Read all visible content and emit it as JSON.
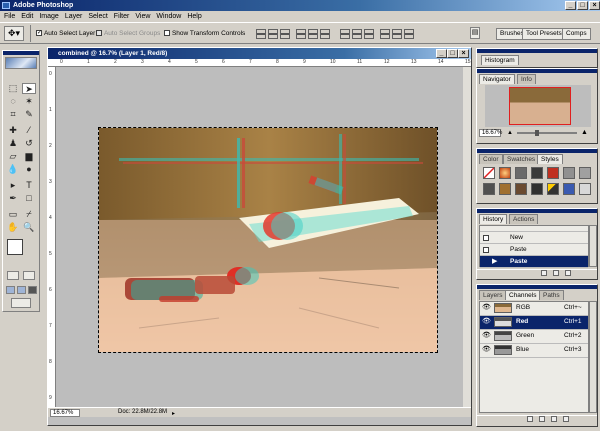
{
  "app": {
    "title": "Adobe Photoshop"
  },
  "menu": [
    "File",
    "Edit",
    "Image",
    "Layer",
    "Select",
    "Filter",
    "View",
    "Window",
    "Help"
  ],
  "options": {
    "auto_select_layer": "Auto Select Layer",
    "auto_select_groups": "Auto Select Groups",
    "show_transform_controls": "Show Transform Controls"
  },
  "palette_well": {
    "tabs": [
      "Brushes",
      "Tool Presets",
      "Comps"
    ]
  },
  "document": {
    "title": "combined @ 16.7% (Layer 1, Red/8)",
    "zoom": "16.67%",
    "doc_size": "Doc: 22.8M/22.8M",
    "ruler_top": [
      "0",
      "1",
      "2",
      "3",
      "4",
      "5",
      "6",
      "7",
      "8",
      "9",
      "10",
      "11",
      "12",
      "13",
      "14",
      "15"
    ],
    "ruler_left": [
      "0",
      "1",
      "2",
      "3",
      "4",
      "5",
      "6",
      "7",
      "8",
      "9"
    ]
  },
  "histogram": {
    "tab": "Histogram"
  },
  "navigator": {
    "tabs": [
      "Navigator",
      "Info"
    ],
    "zoom": "16.67%"
  },
  "color_palette": {
    "tabs": [
      "Color",
      "Swatches",
      "Styles"
    ]
  },
  "history": {
    "tabs": [
      "History",
      "Actions"
    ],
    "items": [
      "New",
      "Paste",
      "Paste"
    ],
    "selected_index": 2
  },
  "layers_palette": {
    "tabs": [
      "Layers",
      "Channels",
      "Paths"
    ],
    "channels": [
      {
        "name": "RGB",
        "shortcut": "Ctrl+~"
      },
      {
        "name": "Red",
        "shortcut": "Ctrl+1"
      },
      {
        "name": "Green",
        "shortcut": "Ctrl+2"
      },
      {
        "name": "Blue",
        "shortcut": "Ctrl+3"
      }
    ],
    "selected_index": 1
  },
  "colors": {
    "titlebar": "#0a246a",
    "chrome": "#d4d0c8",
    "image_warm": "#d8a97a",
    "anaglyph_cyan": "#35c9c0",
    "anaglyph_red": "#e0352b"
  }
}
